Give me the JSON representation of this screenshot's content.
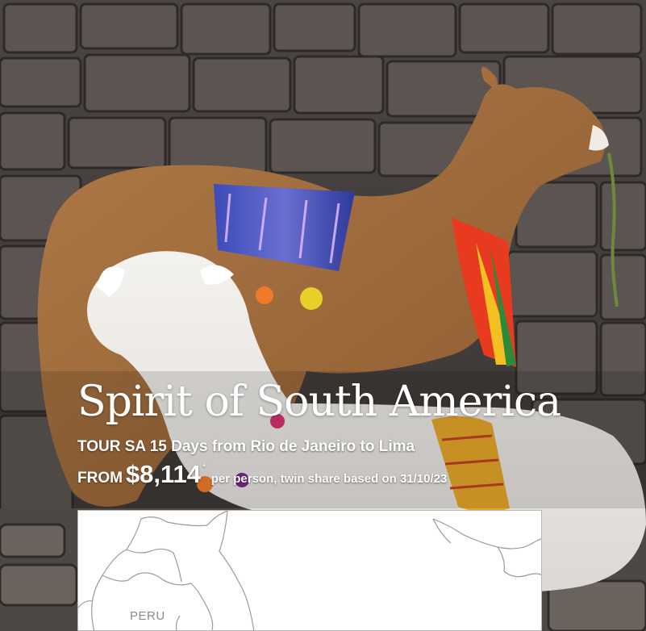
{
  "hero": {
    "title": "Spirit of South America",
    "tour_line": "TOUR SA 15 Days from Rio de Janeiro to Lima",
    "price_prefix": "FROM",
    "price": "$8,114",
    "price_marker": "*",
    "price_terms": "per person, twin share based on 31/10/23"
  },
  "map": {
    "country_label": "PERU"
  },
  "colors": {
    "text": "#ffffff",
    "map_background": "#ffffff",
    "map_label": "#8a8a8a"
  }
}
